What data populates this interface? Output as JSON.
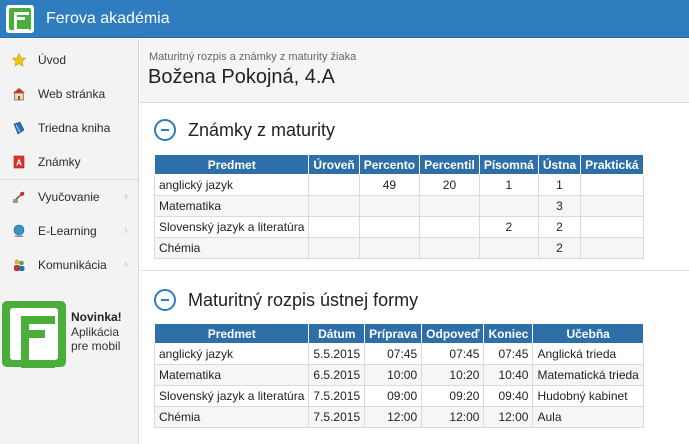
{
  "app": {
    "title": "Ferova akadémia",
    "logo_icon": "edupage-e-logo"
  },
  "sidebar": {
    "items": [
      {
        "label": "Úvod",
        "icon": "star-icon",
        "arrow": false
      },
      {
        "label": "Web stránka",
        "icon": "school-icon",
        "arrow": false
      },
      {
        "label": "Triedna kniha",
        "icon": "book-icon",
        "arrow": false
      },
      {
        "label": "Známky",
        "icon": "grade-icon",
        "arrow": false
      },
      {
        "label": "Vyučovanie",
        "icon": "teaching-icon",
        "arrow": true
      },
      {
        "label": "E-Learning",
        "icon": "globe-icon",
        "arrow": true
      },
      {
        "label": "Komunikácia",
        "icon": "people-icon",
        "arrow": true
      }
    ],
    "promo": {
      "title": "Novinka!",
      "line1": "Aplikácia",
      "line2": "pre mobil"
    }
  },
  "page": {
    "subtitle": "Maturitný rozpis a známky z maturity žiaka",
    "title": "Božena Pokojná, 4.A"
  },
  "grades": {
    "title": "Známky z maturity",
    "headers": [
      "Predmet",
      "Úroveň",
      "Percento",
      "Percentil",
      "Písomná",
      "Ústna",
      "Praktická"
    ],
    "rows": [
      [
        "anglický jazyk",
        "",
        "49",
        "20",
        "1",
        "1",
        ""
      ],
      [
        "Matematika",
        "",
        "",
        "",
        "",
        "3",
        ""
      ],
      [
        "Slovenský jazyk a literatúra",
        "",
        "",
        "",
        "2",
        "2",
        ""
      ],
      [
        "Chémia",
        "",
        "",
        "",
        "",
        "2",
        ""
      ]
    ]
  },
  "schedule": {
    "title": "Maturitný rozpis ústnej formy",
    "headers": [
      "Predmet",
      "Dátum",
      "Príprava",
      "Odpoveď",
      "Koniec",
      "Učebňa"
    ],
    "rows": [
      [
        "anglický jazyk",
        "5.5.2015",
        "07:45",
        "07:45",
        "07:45",
        "Anglická trieda"
      ],
      [
        "Matematika",
        "6.5.2015",
        "10:00",
        "10:20",
        "10:40",
        "Matematická trieda"
      ],
      [
        "Slovenský jazyk a literatúra",
        "7.5.2015",
        "09:00",
        "09:20",
        "09:40",
        "Hudobný kabinet"
      ],
      [
        "Chémia",
        "7.5.2015",
        "12:00",
        "12:00",
        "12:00",
        "Aula"
      ]
    ]
  },
  "colors": {
    "accent": "#2f7cbf",
    "table_header": "#2f6fa9",
    "brand_green": "#4cae3a"
  }
}
